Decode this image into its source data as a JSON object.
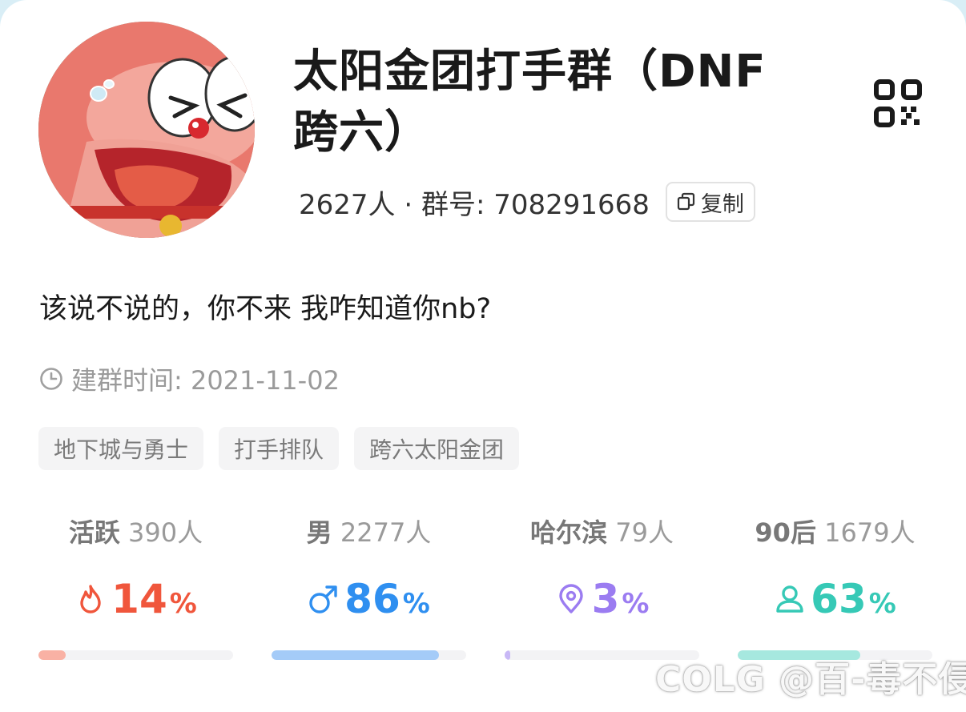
{
  "group": {
    "name": "太阳金团打手群（DNF跨六）",
    "members_text": "2627人 · 群号: 708291668",
    "copy_label": "复制",
    "description": "该说不说的，你不来 我咋知道你nb?",
    "created": "建群时间: 2021-11-02"
  },
  "tags": [
    "地下城与勇士",
    "打手排队",
    "跨六太阳金团"
  ],
  "stats": [
    {
      "key": "活跃",
      "count": "390人",
      "value": "14",
      "unit": "%",
      "icon": "flame-icon",
      "color": "#f0563c",
      "bar_color": "#f9b1a4",
      "fraction": 0.14
    },
    {
      "key": "男",
      "count": "2277人",
      "value": "86",
      "unit": "%",
      "icon": "male-icon",
      "color": "#2f8ff0",
      "bar_color": "#a4cbf8",
      "fraction": 0.86
    },
    {
      "key": "哈尔滨",
      "count": "79人",
      "value": "3",
      "unit": "%",
      "icon": "location-pin-icon",
      "color": "#9b7cf1",
      "bar_color": "#c8b8f6",
      "fraction": 0.03
    },
    {
      "key": "90后",
      "count": "1679人",
      "value": "63",
      "unit": "%",
      "icon": "user-icon",
      "color": "#36c9b6",
      "bar_color": "#a6e8df",
      "fraction": 0.63
    }
  ],
  "watermark": "COLG @百-毒不侵",
  "icons": {
    "qr": "qr-code-icon",
    "copy": "copy-icon",
    "clock": "clock-icon"
  }
}
